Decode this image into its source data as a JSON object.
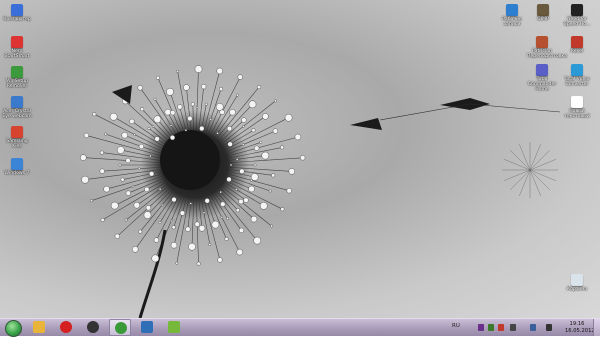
{
  "desktop": {
    "left_icons": [
      {
        "label": "Компьютер",
        "icon": "computer-icon",
        "color": "#3a6ed8"
      },
      {
        "label": "Nero StartSmart",
        "icon": "nero-icon",
        "color": "#d33"
      },
      {
        "label": "WinSetup Remover",
        "icon": "winsetup-icon",
        "color": "#3b9a3b"
      },
      {
        "label": "Acer Crystal Eye webcam",
        "icon": "webcam-icon",
        "color": "#3a7acc"
      },
      {
        "label": "Samsung Kies",
        "icon": "kies-icon",
        "color": "#d6432f"
      },
      {
        "label": "Windows 7",
        "icon": "windows-icon",
        "color": "#3b84d6"
      }
    ],
    "right_icons": [
      {
        "label": "Рабочие записи",
        "icon": "notes-icon",
        "color": "#2f7fd0"
      },
      {
        "label": "GIMP",
        "icon": "gimp-icon",
        "color": "#6a5a3d"
      },
      {
        "label": "Need for Speed Ho...",
        "icon": "nfs-icon",
        "color": "#222"
      },
      {
        "label": "Patrician Переподготовка",
        "icon": "patrician-icon",
        "color": "#b5512e"
      },
      {
        "label": "Rexel",
        "icon": "rexel-icon",
        "color": "#c0392b"
      },
      {
        "label": "Total Commander Home",
        "icon": "commander-icon",
        "color": "#5a5fc8"
      },
      {
        "label": "Total Video Converter",
        "icon": "converter-icon",
        "color": "#2c9ad6"
      },
      {
        "label": "Новый текстовый",
        "icon": "text-file-icon",
        "color": "#ffffff"
      },
      {
        "label": "Корзина",
        "icon": "recycle-bin-icon",
        "color": "#d9e3ec"
      }
    ]
  },
  "taskbar": {
    "pinned": [
      {
        "name": "explorer-icon",
        "color": "#e9b43a"
      },
      {
        "name": "opera-icon",
        "color": "#d42020"
      },
      {
        "name": "aimp-icon",
        "color": "#333333"
      },
      {
        "name": "chrome-icon",
        "color": "#3a9a3a"
      },
      {
        "name": "monitor-icon",
        "color": "#2f6fb8"
      },
      {
        "name": "android-icon",
        "color": "#76b83a"
      }
    ],
    "language": "RU",
    "tray_icons": [
      {
        "name": "tray-app-icon",
        "color": "#6a2f8a"
      },
      {
        "name": "tray-nvidia-icon",
        "color": "#3a7a2a"
      },
      {
        "name": "tray-antivirus-icon",
        "color": "#c0392b"
      },
      {
        "name": "tray-flag-icon",
        "color": "#444444"
      },
      {
        "name": "tray-network-icon",
        "color": "#3a5f9a"
      },
      {
        "name": "tray-volume-icon",
        "color": "#333333"
      }
    ],
    "clock_time": "19:16",
    "clock_date": "16.05.2012"
  }
}
